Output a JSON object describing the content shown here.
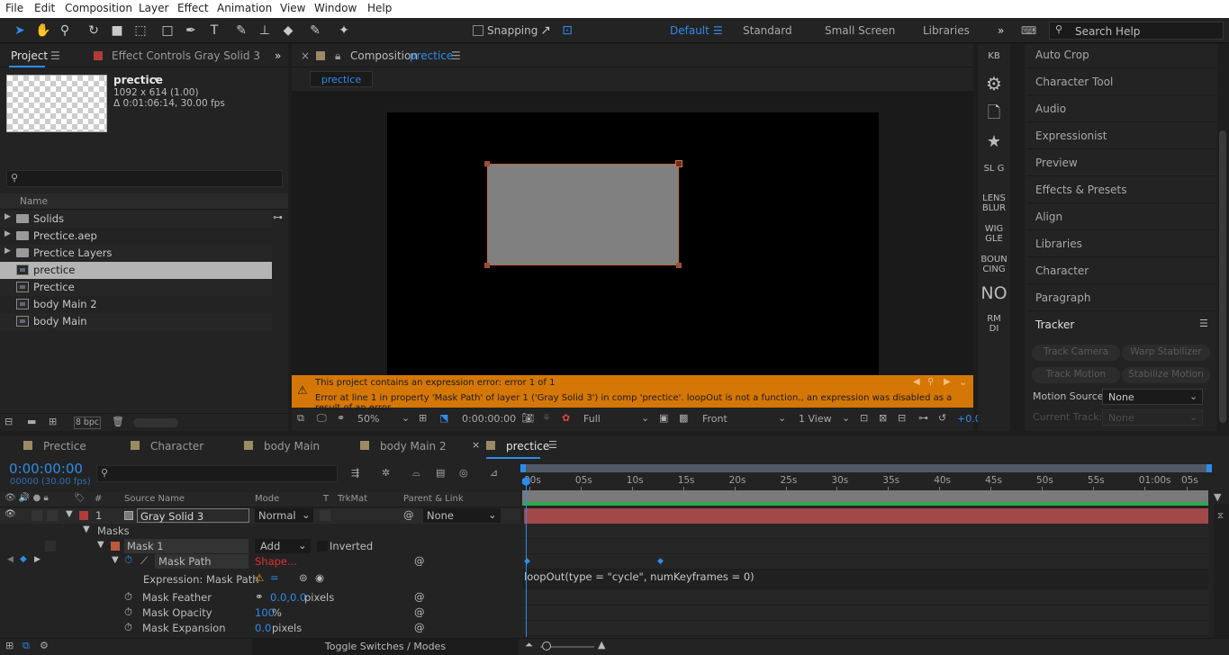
{
  "menu": [
    "File",
    "Edit",
    "Composition",
    "Layer",
    "Effect",
    "Animation",
    "View",
    "Window",
    "Help"
  ],
  "toolbar": {
    "snapping": "Snapping",
    "workspaces": [
      "Default",
      "Standard",
      "Small Screen",
      "Libraries"
    ],
    "search_placeholder": "Search Help"
  },
  "project": {
    "tab": "Project",
    "effect_tab": "Effect Controls Gray Solid 3",
    "comp_name": "prectice",
    "comp_info1": "1092 x 614 (1.00)",
    "comp_info2": "Δ 0:01:06:14, 30.00 fps",
    "col_name": "Name",
    "items": [
      {
        "label": "Solids",
        "type": "folder"
      },
      {
        "label": "Prectice.aep",
        "type": "folder"
      },
      {
        "label": "Prectice Layers",
        "type": "folder"
      },
      {
        "label": "prectice",
        "type": "comp"
      },
      {
        "label": "Prectice",
        "type": "comp"
      },
      {
        "label": "body Main 2",
        "type": "comp"
      },
      {
        "label": "body Main",
        "type": "comp"
      }
    ],
    "bpc": "8 bpc"
  },
  "composition": {
    "tab_prefix": "Composition",
    "tab_name": "prectice",
    "subtab": "prectice",
    "error1": "This project contains an expression error: error 1 of 1",
    "error2": "Error at line 1 in property 'Mask Path' of layer 1 ('Gray Solid 3') in comp 'prectice'. loopOut is not a function., an expression was disabled as a result of an error.",
    "zoom": "50%",
    "time": "0:00:00:00",
    "resolution": "Full",
    "view": "Front",
    "views": "1 View",
    "offset": "+0.0"
  },
  "scripts": [
    "KB",
    "SL G",
    "LENS BLUR",
    "WIG GLE",
    "BOUN CING",
    "NO",
    "RM DI"
  ],
  "right_panels": [
    "Auto Crop",
    "Character Tool",
    "Audio",
    "Expressionist",
    "Preview",
    "Effects & Presets",
    "Align",
    "Libraries",
    "Character",
    "Paragraph"
  ],
  "tracker": {
    "title": "Tracker",
    "track_camera": "Track Camera",
    "warp": "Warp Stabilizer",
    "track_motion": "Track Motion",
    "stabilize": "Stabilize Motion",
    "motion_source_label": "Motion Source:",
    "motion_source": "None",
    "current_track_label": "Current Track:",
    "current_track": "None"
  },
  "timeline": {
    "tabs": [
      "Prectice",
      "Character",
      "body Main",
      "body Main 2",
      "prectice"
    ],
    "timecode": "0:00:00:00",
    "frames": "00000 (30.00 fps)",
    "cols": {
      "num": "#",
      "source": "Source Name",
      "mode": "Mode",
      "t": "T",
      "trkmat": "TrkMat",
      "parent": "Parent & Link"
    },
    "layer": {
      "num": "1",
      "name": "Gray Solid 3",
      "mode": "Normal",
      "parent": "None"
    },
    "masks": "Masks",
    "mask1": "Mask 1",
    "mask_mode": "Add",
    "inverted": "Inverted",
    "mask_path": "Mask Path",
    "shape": "Shape...",
    "expr_label": "Expression: Mask Path",
    "expression": "loopOut(type = \"cycle\", numKeyframes = 0)",
    "feather": "Mask Feather",
    "feather_val": "0.0,0.0",
    "pixels": "pixels",
    "opacity": "Mask Opacity",
    "opacity_val": "100",
    "percent": "%",
    "expansion": "Mask Expansion",
    "expansion_val": "0.0",
    "toggle": "Toggle Switches / Modes",
    "ruler": [
      "00s",
      "05s",
      "10s",
      "15s",
      "20s",
      "25s",
      "30s",
      "35s",
      "40s",
      "45s",
      "50s",
      "55s",
      "01:00s",
      "05s"
    ]
  },
  "colors": {
    "accent": "#2d8ceb",
    "error_bar": "#d97706",
    "layer_bar": "#a24848",
    "solid": "#808080"
  }
}
